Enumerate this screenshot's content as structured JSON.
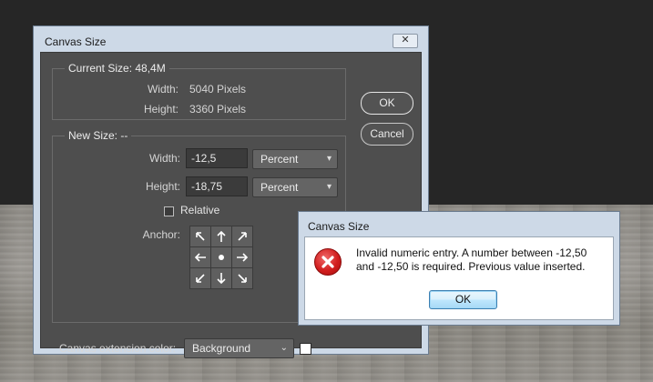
{
  "canvas_dialog": {
    "title": "Canvas Size",
    "close_glyph": "✕",
    "current_size": {
      "title": "Current Size: 48,4M",
      "width_label": "Width:",
      "width_value": "5040 Pixels",
      "height_label": "Height:",
      "height_value": "3360 Pixels"
    },
    "new_size": {
      "title": "New Size: --",
      "width_label": "Width:",
      "width_value": "-12,5",
      "width_unit": "Percent",
      "height_label": "Height:",
      "height_value": "-18,75",
      "height_unit": "Percent",
      "relative_label": "Relative",
      "relative_checked": false,
      "anchor_label": "Anchor:"
    },
    "ok_label": "OK",
    "cancel_label": "Cancel",
    "extension_color_label": "Canvas extension color:",
    "extension_color_value": "Background",
    "extension_color_swatch": "#ffffff"
  },
  "error_dialog": {
    "title": "Canvas Size",
    "message": "Invalid numeric entry. A number between -12,50\nand -12,50 is required.  Previous value inserted.",
    "ok_label": "OK",
    "icon": "error-icon"
  },
  "colors": {
    "dialog_chrome": "#cdd9e7",
    "panel_bg": "#4e4e4e",
    "error_red": "#d21e1e"
  }
}
